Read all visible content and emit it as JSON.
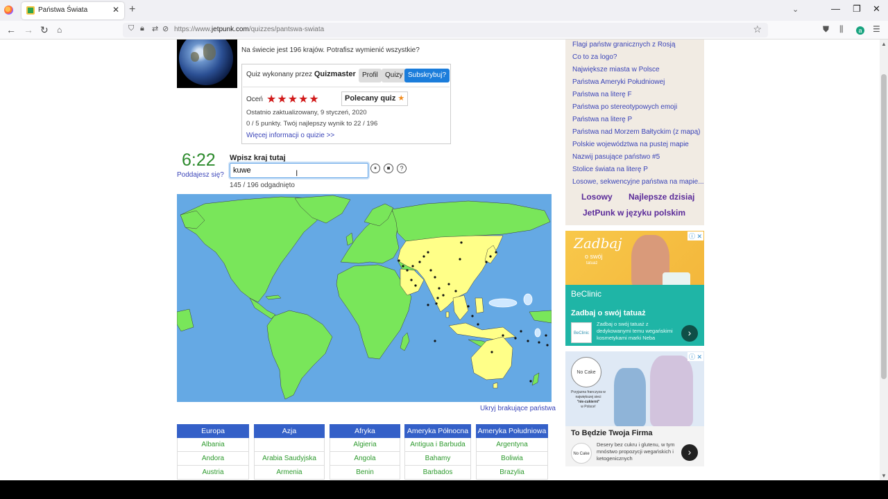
{
  "browser": {
    "tab_title": "Państwa Świata",
    "url_prefix": "https://www.",
    "url_domain": "jetpunk.com",
    "url_path": "/quizzes/pantswa-swiata"
  },
  "quiz": {
    "intro": "Na świecie jest 196 krajów. Potrafisz wymienić wszystkie?",
    "made_by_prefix": "Quiz wykonany przez",
    "author": "Quizmaster",
    "btn_profile": "Profil",
    "btn_quizzes": "Quizy",
    "btn_subscribe": "Subskrybuj?",
    "rate_label": "Oceń",
    "stars": "★★★★★",
    "featured_label": "Polecany quiz",
    "last_updated": "Ostatnio zaktualizowany, 9 styczeń, 2020",
    "score_line": "0 / 5 punkty. Twój najlepszy wynik to 22 / 196",
    "more_info": "Więcej informacji o quizie >>",
    "timer": "6:22",
    "give_up": "Poddajesz się?",
    "prompt_label": "Wpisz kraj tutaj",
    "answer_value": "kuwe",
    "progress": "145 / 196 odgadnięto",
    "hide_missing": "Ukryj brakujące państwa",
    "map_colors": {
      "ocean": "#65a9e4",
      "guessed": "#79e65a",
      "missing": "#ffff88",
      "border": "#3b3b3b"
    }
  },
  "table": {
    "columns": [
      {
        "header": "Europa",
        "cells": [
          "Albania",
          "Andora",
          "Austria"
        ]
      },
      {
        "header": "Azja",
        "cells": [
          "",
          "Arabia Saudyjska",
          "Armenia"
        ]
      },
      {
        "header": "Afryka",
        "cells": [
          "Algieria",
          "Angola",
          "Benin"
        ]
      },
      {
        "header": "Ameryka Północna",
        "cells": [
          "Antigua i Barbuda",
          "Bahamy",
          "Barbados"
        ]
      },
      {
        "header": "Ameryka Południowa",
        "cells": [
          "Argentyna",
          "Boliwia",
          "Brazylia"
        ]
      }
    ]
  },
  "sidebar": {
    "links": [
      "Flagi państw granicznych z Rosją",
      "Co to za logo?",
      "Największe miasta w Polsce",
      "Państwa Ameryki Południowej",
      "Państwa na literę F",
      "Państwa po stereotypowych emoji",
      "Państwa na literę P",
      "Państwa nad Morzem Bałtyckim (z mapą)",
      "Polskie województwa na pustej mapie",
      "Nazwij pasujące państwo #5",
      "Stolice świata na literę P",
      "Losowe, sekwencyjne państwa na mapie..."
    ],
    "random": "Losowy",
    "best_today": "Najlepsze dzisiaj",
    "polish": "JetPunk w języku polskim"
  },
  "ads": [
    {
      "image_text_1": "Zadbaj",
      "image_text_2": "o swój",
      "image_text_3": "tatuaż",
      "brand": "BeClinic",
      "headline": "Zadbaj o swój tatuaż",
      "logo": "BeClinic",
      "desc": "Zadbaj o swój tatuaż z dedykowanymi temu wegańskimi kosmetykami marki Neba"
    },
    {
      "image_text_1": "Przyjazna franczyza w największej sieci",
      "image_text_2": "\"nie-cukierni\"",
      "image_text_3": "w Polsce!",
      "brand": "No Cake",
      "headline": "To Będzie Twoja Firma",
      "logo": "No Cake",
      "desc": "Desery bez cukru i glutenu, w tym mnóstwo propozycji wegańskich i ketogenicznych"
    }
  ]
}
